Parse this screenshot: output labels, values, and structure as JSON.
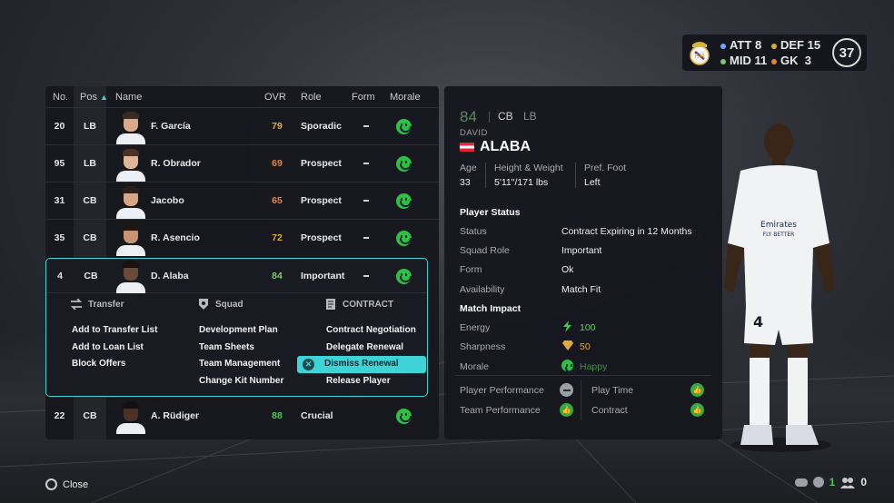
{
  "badge": {
    "att_label": "ATT",
    "att_value": "8",
    "def_label": "DEF",
    "def_value": "15",
    "mid_label": "MID",
    "mid_value": "11",
    "gk_label": "GK",
    "gk_value": "3",
    "rating": "37"
  },
  "table": {
    "headers": {
      "no": "No.",
      "pos": "Pos",
      "name": "Name",
      "ovr": "OVR",
      "role": "Role",
      "form": "Form",
      "morale": "Morale"
    },
    "rows": [
      {
        "no": "20",
        "pos": "LB",
        "name": "F. García",
        "ovr": "79",
        "ovr_color": "#e0a93b",
        "role": "Sporadic"
      },
      {
        "no": "95",
        "pos": "LB",
        "name": "R. Obrador",
        "ovr": "69",
        "ovr_color": "#e2843a",
        "role": "Prospect"
      },
      {
        "no": "31",
        "pos": "CB",
        "name": "Jacobo",
        "ovr": "65",
        "ovr_color": "#e2843a",
        "role": "Prospect"
      },
      {
        "no": "35",
        "pos": "CB",
        "name": "R. Asencio",
        "ovr": "72",
        "ovr_color": "#e0a93b",
        "role": "Prospect"
      },
      {
        "no": "4",
        "pos": "CB",
        "name": "D. Alaba",
        "ovr": "84",
        "ovr_color": "#7cc86a",
        "role": "Important"
      },
      {
        "no": "22",
        "pos": "CB",
        "name": "A. Rüdiger",
        "ovr": "88",
        "ovr_color": "#4cc45a",
        "role": "Crucial"
      }
    ]
  },
  "menu": {
    "transfer": {
      "title": "Transfer",
      "items": [
        "Add to Transfer List",
        "Add to Loan List",
        "Block Offers"
      ]
    },
    "squad": {
      "title": "Squad",
      "items": [
        "Development Plan",
        "Team Sheets",
        "Team Management",
        "Change Kit Number"
      ]
    },
    "contract": {
      "title": "CONTRACT",
      "items": [
        "Contract Negotiation",
        "Delegate Renewal",
        "Dismiss Renewal",
        "Release Player"
      ]
    }
  },
  "player": {
    "ovr": "84",
    "pos_main": "CB",
    "pos_alt": "LB",
    "first_name": "DAVID",
    "last_name": "ALABA",
    "age_label": "Age",
    "age": "33",
    "hw_label": "Height & Weight",
    "hw": "5'11\"/171 lbs",
    "foot_label": "Pref. Foot",
    "foot": "Left",
    "status_section": "Player Status",
    "status_label": "Status",
    "status": "Contract Expiring in 12 Months",
    "role_label": "Squad Role",
    "role": "Important",
    "form_label": "Form",
    "form": "Ok",
    "avail_label": "Availability",
    "avail": "Match Fit",
    "impact_section": "Match Impact",
    "energy_label": "Energy",
    "energy": "100",
    "sharp_label": "Sharpness",
    "sharp": "50",
    "morale_label": "Morale",
    "morale": "Happy",
    "perf_label": "Player Performance",
    "play_label": "Play Time",
    "team_perf_label": "Team Performance",
    "contract_label": "Contract"
  },
  "footer": {
    "close_label": "Close",
    "count_a": "1",
    "count_b": "0"
  },
  "colors": {
    "accent": "#3ed3d6",
    "green": "#2fbf45",
    "gold": "#e0a93b"
  }
}
